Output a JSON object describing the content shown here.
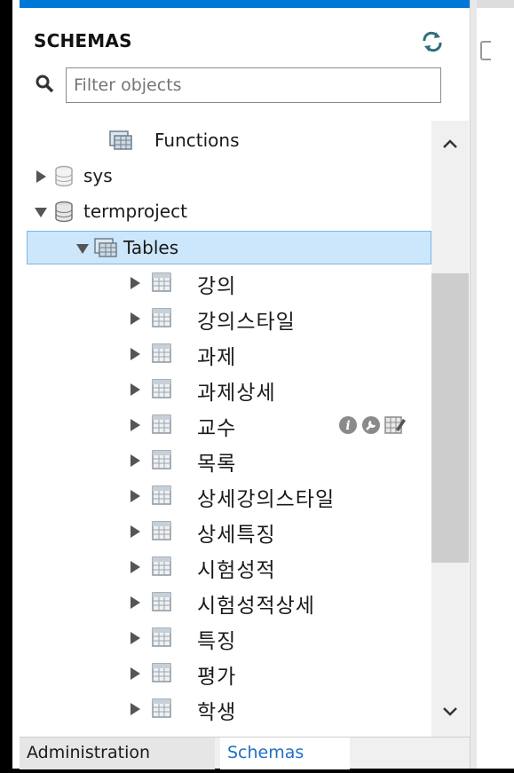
{
  "header": {
    "title": "SCHEMAS"
  },
  "filter": {
    "placeholder": "Filter objects",
    "value": ""
  },
  "tree": {
    "functions_label": "Functions",
    "sys_label": "sys",
    "termproject_label": "termproject",
    "tables_label": "Tables",
    "tables": [
      "강의",
      "강의스타일",
      "과제",
      "과제상세",
      "교수",
      "목록",
      "상세강의스타일",
      "상세특징",
      "시험성적",
      "시험성적상세",
      "특징",
      "평가",
      "학생"
    ]
  },
  "tabs": {
    "administration": "Administration",
    "schemas": "Schemas"
  },
  "colors": {
    "accent": "#0078d7",
    "selection_bg": "#cce6fb",
    "selection_border": "#7ab8ea",
    "tab_active_text": "#1f6fc6"
  },
  "icons": {
    "refresh": "refresh-icon",
    "search": "search-icon",
    "database": "database-icon",
    "folder": "table-folder-icon",
    "table": "table-icon",
    "info": "info-icon",
    "wrench": "wrench-icon",
    "grid": "grid-edit-icon"
  }
}
